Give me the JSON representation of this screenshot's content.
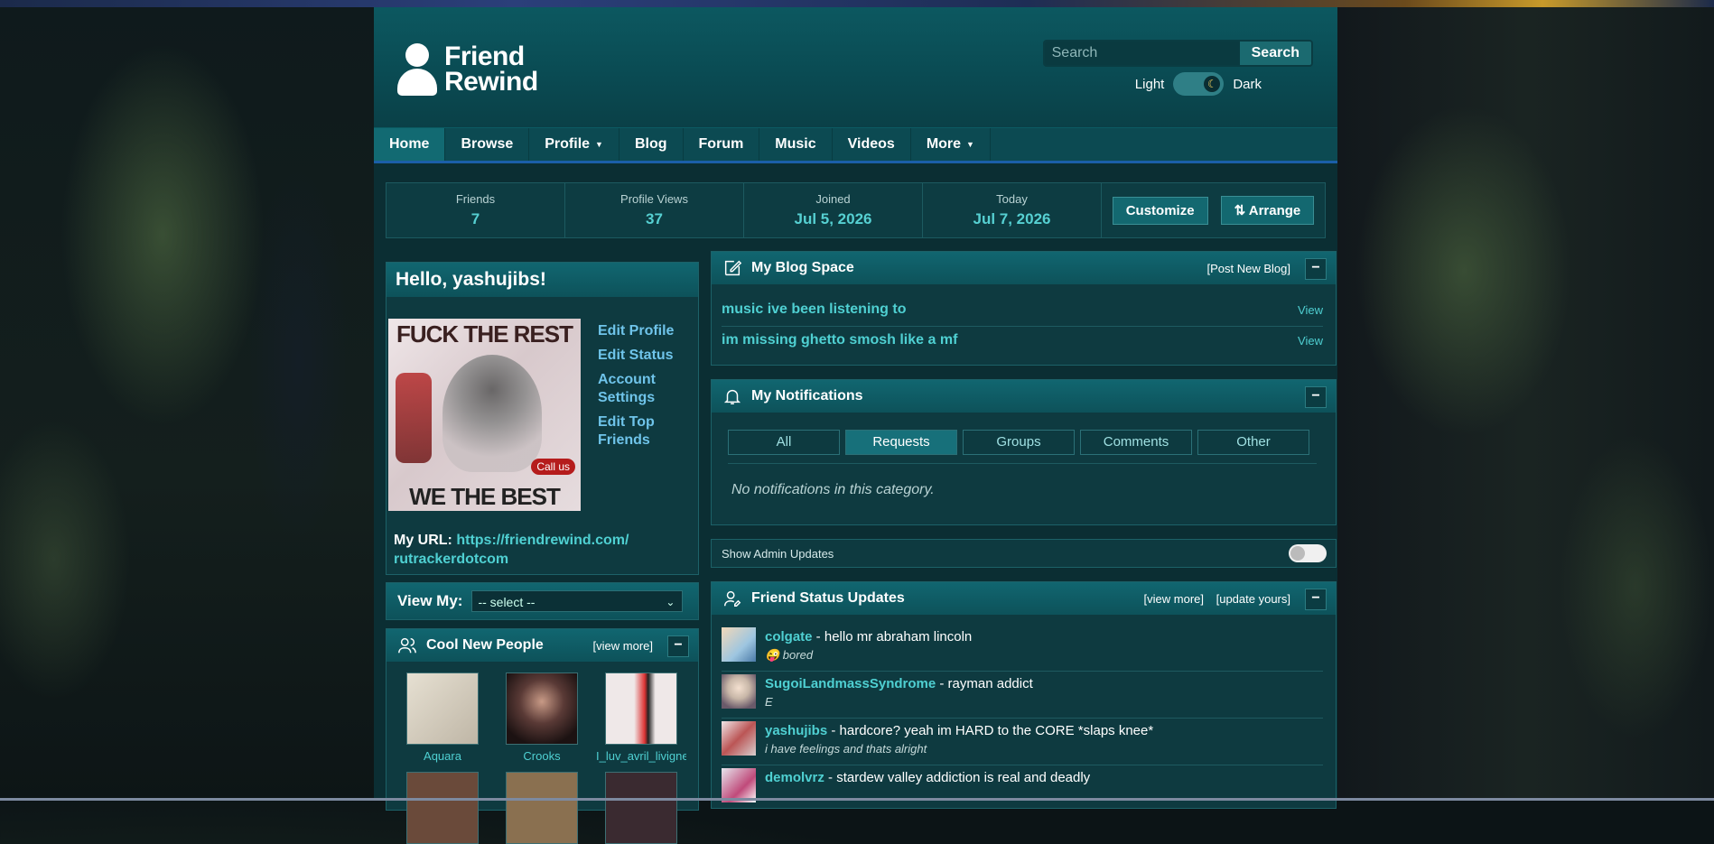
{
  "site": {
    "logo_line1": "Friend",
    "logo_line2": "Rewind"
  },
  "search": {
    "placeholder": "Search",
    "button": "Search"
  },
  "theme": {
    "light_label": "Light",
    "dark_label": "Dark",
    "mode": "dark"
  },
  "nav": [
    {
      "label": "Home",
      "active": true
    },
    {
      "label": "Browse"
    },
    {
      "label": "Profile",
      "dropdown": true
    },
    {
      "label": "Blog"
    },
    {
      "label": "Forum"
    },
    {
      "label": "Music"
    },
    {
      "label": "Videos"
    },
    {
      "label": "More",
      "dropdown": true
    }
  ],
  "stats": [
    {
      "label": "Friends",
      "value": "7"
    },
    {
      "label": "Profile Views",
      "value": "37"
    },
    {
      "label": "Joined",
      "value": "Jul 5, 2026"
    },
    {
      "label": "Today",
      "value": "Jul 7, 2026"
    }
  ],
  "stat_buttons": {
    "customize": "Customize",
    "arrange": "⇅ Arrange"
  },
  "hello": {
    "greeting": "Hello, yashujibs!",
    "avatar_text_top": "FUCK THE REST",
    "avatar_text_bottom": "WE THE BEST",
    "avatar_badge": "Call us",
    "links": [
      "Edit Profile",
      "Edit Status",
      "Account Settings",
      "Edit Top Friends"
    ],
    "url_label": "My URL:",
    "url": "https://friendrewind.com/ rutrackerdotcom"
  },
  "view_my": {
    "label": "View My:",
    "selected": "-- select --"
  },
  "cool_people": {
    "title": "Cool New People",
    "view_more": "[view more]",
    "people": [
      {
        "name": "Aquara",
        "color": "#d9d2c4"
      },
      {
        "name": "Crooks",
        "color": "#5a3a36"
      },
      {
        "name": "I_luv_avril_livigne",
        "color": "#e8e2e0"
      }
    ]
  },
  "blog": {
    "title": "My Blog Space",
    "post_link": "[Post New Blog]",
    "entries": [
      {
        "title": "music ive been listening to",
        "action": "View"
      },
      {
        "title": "im missing ghetto smosh like a mf",
        "action": "View"
      }
    ]
  },
  "notifications": {
    "title": "My Notifications",
    "tabs": [
      {
        "label": "All"
      },
      {
        "label": "Requests",
        "active": true
      },
      {
        "label": "Groups"
      },
      {
        "label": "Comments"
      },
      {
        "label": "Other"
      }
    ],
    "empty": "No notifications in this category."
  },
  "admin": {
    "label": "Show Admin Updates",
    "on": false
  },
  "status_updates": {
    "title": "Friend Status Updates",
    "view_more": "[view more]",
    "update": "[update yours]",
    "items": [
      {
        "user": "colgate",
        "text": " - hello mr abraham lincoln",
        "mood": "😜 bored",
        "color": "#9ec6e0"
      },
      {
        "user": "SugoiLandmassSyndrome",
        "text": " - rayman addict",
        "mood": "E",
        "color": "#c8b7a8"
      },
      {
        "user": "yashujibs",
        "text": " - hardcore? yeah im HARD to the CORE *slaps knee*",
        "mood": "i have feelings and thats alright",
        "color": "#d8cfcf"
      },
      {
        "user": "demolvrz",
        "text": " - stardew valley addiction is real and deadly",
        "mood": "",
        "color": "#e6e6ee"
      }
    ]
  },
  "collapse_symbol": "−"
}
